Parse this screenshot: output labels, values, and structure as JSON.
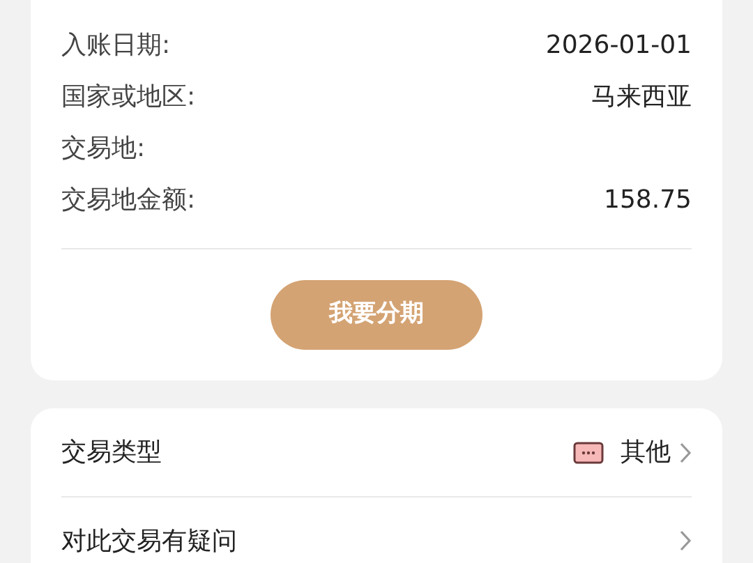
{
  "details": [
    {
      "label": "入账日期:",
      "value": "2026-01-01"
    },
    {
      "label": "国家或地区:",
      "value": "马来西亚"
    },
    {
      "label": "交易地:"
    },
    {
      "label": "交易地金额:",
      "value": "158.75"
    }
  ],
  "installment_button": "我要分期",
  "menu": [
    {
      "label": "交易类型",
      "value": "其他",
      "kind": "category"
    },
    {
      "label": "对此交易有疑问",
      "kind": "link"
    }
  ]
}
